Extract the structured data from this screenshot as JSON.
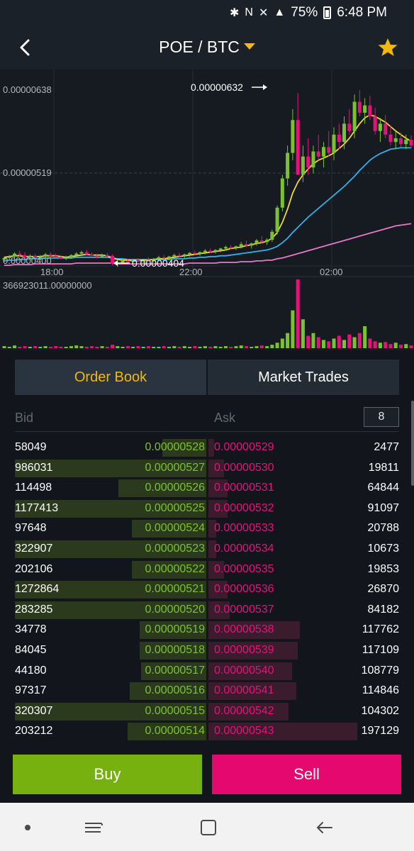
{
  "status_bar": {
    "battery": "75%",
    "time": "6:48 PM"
  },
  "header": {
    "pair": "POE / BTC"
  },
  "chart_data": {
    "type": "candlestick",
    "price_labels": [
      "0.00000638",
      "0.00000519",
      "0.00000400"
    ],
    "x_tick_labels": [
      "18:00",
      "22:00",
      "02:00"
    ],
    "high_marker": "0.00000632",
    "low_marker": "0.00000404",
    "volume_label": "366923011.00000000",
    "ylim": [
      400,
      638
    ],
    "candles": [
      [
        404,
        408,
        401,
        406
      ],
      [
        406,
        410,
        403,
        408
      ],
      [
        408,
        414,
        405,
        412
      ],
      [
        412,
        416,
        408,
        410
      ],
      [
        410,
        414,
        406,
        407
      ],
      [
        407,
        411,
        404,
        409
      ],
      [
        409,
        412,
        405,
        406
      ],
      [
        406,
        410,
        403,
        408
      ],
      [
        408,
        413,
        406,
        411
      ],
      [
        411,
        414,
        407,
        409
      ],
      [
        409,
        412,
        406,
        407
      ],
      [
        407,
        410,
        404,
        405
      ],
      [
        405,
        409,
        403,
        407
      ],
      [
        407,
        411,
        405,
        410
      ],
      [
        410,
        414,
        407,
        412
      ],
      [
        412,
        416,
        409,
        414
      ],
      [
        414,
        417,
        410,
        411
      ],
      [
        411,
        414,
        407,
        409
      ],
      [
        409,
        412,
        405,
        408
      ],
      [
        408,
        412,
        406,
        410
      ],
      [
        410,
        413,
        407,
        409
      ],
      [
        409,
        411,
        396,
        398
      ],
      [
        398,
        402,
        394,
        400
      ],
      [
        400,
        404,
        397,
        402
      ],
      [
        402,
        405,
        399,
        401
      ],
      [
        401,
        404,
        398,
        403
      ],
      [
        403,
        406,
        400,
        402
      ],
      [
        402,
        405,
        399,
        404
      ],
      [
        404,
        407,
        401,
        403
      ],
      [
        403,
        406,
        400,
        405
      ],
      [
        405,
        409,
        402,
        407
      ],
      [
        407,
        410,
        404,
        406
      ],
      [
        406,
        409,
        403,
        408
      ],
      [
        408,
        412,
        405,
        410
      ],
      [
        410,
        413,
        407,
        409
      ],
      [
        409,
        412,
        406,
        411
      ],
      [
        411,
        414,
        408,
        413
      ],
      [
        413,
        416,
        410,
        412
      ],
      [
        412,
        415,
        409,
        414
      ],
      [
        414,
        418,
        411,
        416
      ],
      [
        416,
        419,
        413,
        415
      ],
      [
        415,
        418,
        412,
        417
      ],
      [
        417,
        420,
        414,
        419
      ],
      [
        419,
        423,
        416,
        421
      ],
      [
        421,
        424,
        418,
        420
      ],
      [
        420,
        423,
        417,
        422
      ],
      [
        422,
        428,
        419,
        425
      ],
      [
        425,
        430,
        421,
        423
      ],
      [
        423,
        427,
        419,
        426
      ],
      [
        426,
        432,
        423,
        430
      ],
      [
        430,
        436,
        426,
        428
      ],
      [
        428,
        433,
        424,
        431
      ],
      [
        431,
        445,
        428,
        442
      ],
      [
        442,
        478,
        438,
        475
      ],
      [
        475,
        520,
        470,
        515
      ],
      [
        515,
        560,
        505,
        550
      ],
      [
        550,
        610,
        540,
        595
      ],
      [
        595,
        632,
        560,
        520
      ],
      [
        520,
        560,
        510,
        545
      ],
      [
        545,
        570,
        520,
        530
      ],
      [
        530,
        560,
        522,
        552
      ],
      [
        552,
        575,
        540,
        545
      ],
      [
        545,
        565,
        530,
        558
      ],
      [
        558,
        580,
        545,
        550
      ],
      [
        550,
        585,
        540,
        575
      ],
      [
        575,
        590,
        555,
        565
      ],
      [
        565,
        600,
        555,
        590
      ],
      [
        590,
        610,
        575,
        580
      ],
      [
        580,
        630,
        570,
        620
      ],
      [
        620,
        636,
        600,
        605
      ],
      [
        605,
        625,
        590,
        615
      ],
      [
        615,
        628,
        595,
        600
      ],
      [
        600,
        612,
        575,
        580
      ],
      [
        580,
        598,
        565,
        590
      ],
      [
        590,
        602,
        570,
        575
      ],
      [
        575,
        588,
        560,
        565
      ],
      [
        565,
        580,
        555,
        570
      ],
      [
        570,
        578,
        558,
        562
      ],
      [
        562,
        575,
        555,
        568
      ],
      [
        568,
        574,
        556,
        560
      ]
    ],
    "ma7": [
      407,
      408,
      409,
      409,
      408,
      408,
      408,
      408,
      409,
      409,
      409,
      408,
      407,
      408,
      409,
      410,
      411,
      410,
      410,
      410,
      409,
      406,
      404,
      403,
      403,
      402,
      402,
      403,
      403,
      404,
      405,
      405,
      406,
      407,
      408,
      409,
      410,
      411,
      412,
      413,
      414,
      415,
      416,
      417,
      419,
      420,
      421,
      423,
      424,
      426,
      427,
      429,
      433,
      441,
      455,
      473,
      495,
      510,
      520,
      528,
      535,
      540,
      543,
      546,
      550,
      556,
      562,
      570,
      580,
      590,
      598,
      602,
      600,
      596,
      592,
      586,
      580,
      575,
      570,
      566
    ],
    "ma25": [
      402,
      403,
      403,
      404,
      404,
      405,
      405,
      405,
      406,
      406,
      406,
      406,
      406,
      406,
      407,
      407,
      407,
      407,
      407,
      407,
      407,
      406,
      405,
      405,
      404,
      404,
      404,
      404,
      404,
      404,
      404,
      404,
      404,
      405,
      405,
      405,
      406,
      406,
      407,
      407,
      408,
      408,
      409,
      409,
      410,
      411,
      412,
      413,
      414,
      415,
      416,
      417,
      419,
      422,
      427,
      433,
      441,
      448,
      455,
      462,
      468,
      474,
      480,
      486,
      492,
      498,
      504,
      511,
      518,
      526,
      533,
      540,
      545,
      549,
      552,
      555,
      556,
      557,
      557,
      557
    ],
    "ma99": [
      396,
      396,
      397,
      397,
      397,
      397,
      398,
      398,
      398,
      398,
      398,
      398,
      398,
      398,
      399,
      399,
      399,
      399,
      399,
      399,
      399,
      399,
      398,
      398,
      398,
      398,
      398,
      398,
      398,
      398,
      398,
      398,
      398,
      398,
      398,
      398,
      399,
      399,
      399,
      399,
      399,
      399,
      400,
      400,
      400,
      400,
      401,
      401,
      401,
      402,
      402,
      403,
      403,
      405,
      406,
      408,
      410,
      412,
      414,
      416,
      418,
      420,
      422,
      424,
      426,
      428,
      430,
      432,
      434,
      436,
      438,
      440,
      442,
      444,
      446,
      448,
      450,
      451,
      452,
      453
    ],
    "volumes": [
      3,
      2,
      4,
      2,
      3,
      2,
      3,
      2,
      3,
      2,
      3,
      2,
      2,
      3,
      4,
      3,
      2,
      3,
      2,
      3,
      2,
      5,
      3,
      2,
      3,
      2,
      3,
      2,
      3,
      2,
      2,
      3,
      2,
      3,
      2,
      3,
      2,
      3,
      2,
      3,
      2,
      3,
      2,
      3,
      2,
      3,
      4,
      3,
      2,
      3,
      4,
      3,
      5,
      8,
      14,
      22,
      55,
      100,
      42,
      18,
      22,
      16,
      12,
      10,
      14,
      18,
      12,
      20,
      16,
      22,
      32,
      14,
      10,
      8,
      9,
      6,
      8,
      5,
      6,
      4
    ]
  },
  "tabs": {
    "order_book": "Order Book",
    "market_trades": "Market Trades"
  },
  "book": {
    "bid_label": "Bid",
    "ask_label": "Ask",
    "precision": "8",
    "rows": [
      {
        "bid_qty": "58049",
        "bid_price": "0.00000528",
        "bid_depth": 0.23,
        "ask_price": "0.00000529",
        "ask_qty": "2477",
        "ask_depth": 0.03
      },
      {
        "bid_qty": "986031",
        "bid_price": "0.00000527",
        "bid_depth": 1.0,
        "ask_price": "0.00000530",
        "ask_qty": "19811",
        "ask_depth": 0.08
      },
      {
        "bid_qty": "114498",
        "bid_price": "0.00000526",
        "bid_depth": 0.46,
        "ask_price": "0.00000531",
        "ask_qty": "64844",
        "ask_depth": 0.1
      },
      {
        "bid_qty": "1177413",
        "bid_price": "0.00000525",
        "bid_depth": 1.0,
        "ask_price": "0.00000532",
        "ask_qty": "91097",
        "ask_depth": 0.1
      },
      {
        "bid_qty": "97648",
        "bid_price": "0.00000524",
        "bid_depth": 0.39,
        "ask_price": "0.00000533",
        "ask_qty": "20788",
        "ask_depth": 0.04
      },
      {
        "bid_qty": "322907",
        "bid_price": "0.00000523",
        "bid_depth": 1.0,
        "ask_price": "0.00000534",
        "ask_qty": "10673",
        "ask_depth": 0.04
      },
      {
        "bid_qty": "202106",
        "bid_price": "0.00000522",
        "bid_depth": 0.39,
        "ask_price": "0.00000535",
        "ask_qty": "19853",
        "ask_depth": 0.08
      },
      {
        "bid_qty": "1272864",
        "bid_price": "0.00000521",
        "bid_depth": 1.0,
        "ask_price": "0.00000536",
        "ask_qty": "26870",
        "ask_depth": 0.1
      },
      {
        "bid_qty": "283285",
        "bid_price": "0.00000520",
        "bid_depth": 1.0,
        "ask_price": "0.00000537",
        "ask_qty": "84182",
        "ask_depth": 0.11
      },
      {
        "bid_qty": "34778",
        "bid_price": "0.00000519",
        "bid_depth": 0.35,
        "ask_price": "0.00000538",
        "ask_qty": "117762",
        "ask_depth": 0.48
      },
      {
        "bid_qty": "84045",
        "bid_price": "0.00000518",
        "bid_depth": 0.35,
        "ask_price": "0.00000539",
        "ask_qty": "117109",
        "ask_depth": 0.47
      },
      {
        "bid_qty": "44180",
        "bid_price": "0.00000517",
        "bid_depth": 0.34,
        "ask_price": "0.00000540",
        "ask_qty": "108779",
        "ask_depth": 0.44
      },
      {
        "bid_qty": "97317",
        "bid_price": "0.00000516",
        "bid_depth": 0.4,
        "ask_price": "0.00000541",
        "ask_qty": "114846",
        "ask_depth": 0.46
      },
      {
        "bid_qty": "320307",
        "bid_price": "0.00000515",
        "bid_depth": 1.0,
        "ask_price": "0.00000542",
        "ask_qty": "104302",
        "ask_depth": 0.42
      },
      {
        "bid_qty": "203212",
        "bid_price": "0.00000514",
        "bid_depth": 0.41,
        "ask_price": "0.00000543",
        "ask_qty": "197129",
        "ask_depth": 0.78
      }
    ]
  },
  "actions": {
    "buy": "Buy",
    "sell": "Sell"
  },
  "colors": {
    "up": "#7ac231",
    "down": "#e8107a",
    "ma7": "#f0d83a",
    "ma25": "#35b0e8",
    "ma99": "#e878c8",
    "accent": "#f0b90b"
  }
}
